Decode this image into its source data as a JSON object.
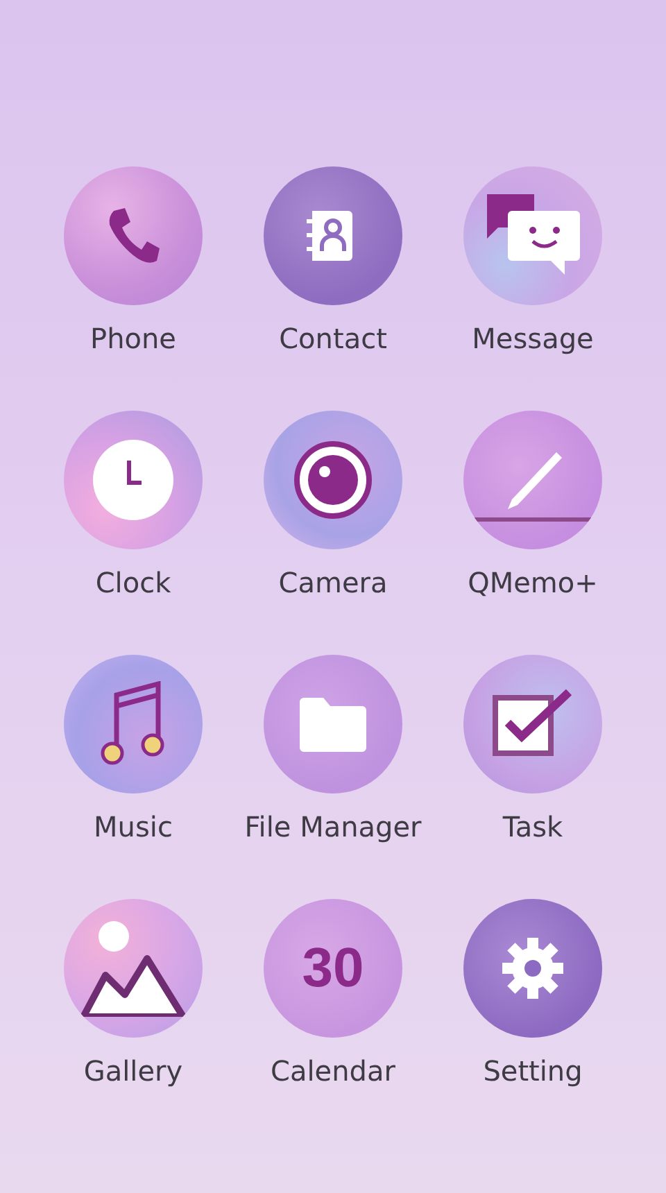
{
  "apps": [
    {
      "label": "Phone",
      "kind": "phone"
    },
    {
      "label": "Contact",
      "kind": "contact"
    },
    {
      "label": "Message",
      "kind": "message"
    },
    {
      "label": "Clock",
      "kind": "clock"
    },
    {
      "label": "Camera",
      "kind": "camera"
    },
    {
      "label": "QMemo+",
      "kind": "memo"
    },
    {
      "label": "Music",
      "kind": "music"
    },
    {
      "label": "File Manager",
      "kind": "folder"
    },
    {
      "label": "Task",
      "kind": "task"
    },
    {
      "label": "Gallery",
      "kind": "gallery"
    },
    {
      "label": "Calendar",
      "kind": "calendar"
    },
    {
      "label": "Setting",
      "kind": "settings"
    }
  ],
  "calendar_icon": {
    "date": "30"
  }
}
